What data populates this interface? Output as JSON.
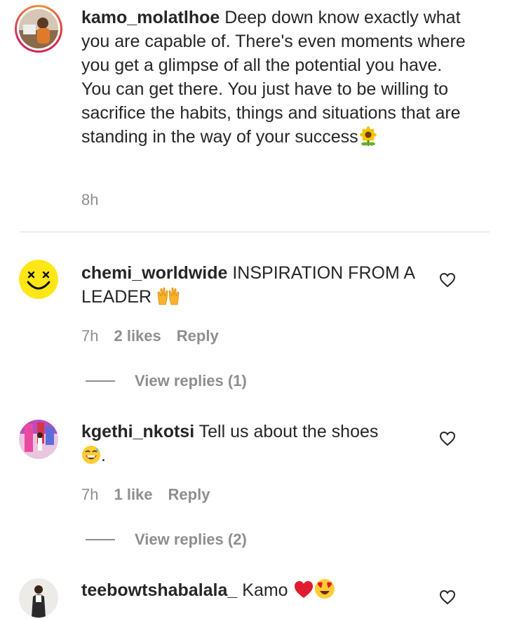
{
  "comments": [
    {
      "username": "kamo_molatlhoe",
      "text": "Deep down know exactly what you are capable of. There's even moments where you get a glimpse of all the potential you have. You can get there. You just have to be willing to sacrifice the habits, things and situations that are standing in the way of your success",
      "emoji": "sunflower",
      "time": "8h",
      "avatar_icon": "profile-photo"
    },
    {
      "username": "chemi_worldwide",
      "text": "INSPIRATION FROM A LEADER",
      "emoji": "raised-hands",
      "time": "7h",
      "likes": "2 likes",
      "reply": "Reply",
      "view_replies": "View replies (1)",
      "avatar_icon": "smiley-face"
    },
    {
      "username": "kgethi_nkotsi",
      "text": "Tell us about the shoes",
      "emoji_text": ".",
      "emoji": "grinning-sweat",
      "time": "7h",
      "likes": "1 like",
      "reply": "Reply",
      "view_replies": "View replies (2)",
      "avatar_icon": "profile-photo"
    },
    {
      "username": "teebowtshabalala_",
      "text": "Kamo",
      "emoji": "red-heart heart-eyes",
      "avatar_icon": "profile-photo"
    }
  ],
  "colors": {
    "text": "#262626",
    "secondary": "#8e8e8e",
    "divider": "#dbdbdb",
    "story_ring_start": "#f09433",
    "story_ring_end": "#dc2743"
  }
}
